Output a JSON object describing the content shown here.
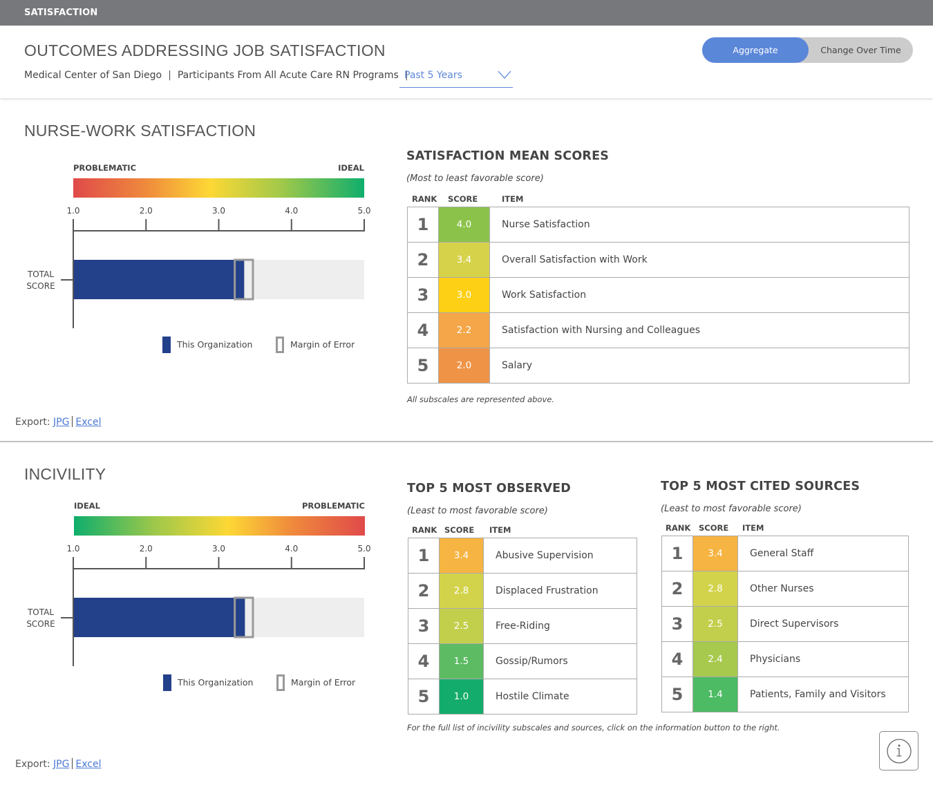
{
  "topbar": {
    "title": "SATISFACTION"
  },
  "header": {
    "title": "OUTCOMES ADDRESSING JOB SATISFACTION",
    "organization": "Medical Center of San Diego",
    "participants": "Participants From All Acute Care RN Programs",
    "separator": "|",
    "period_select": {
      "value": "Past 5 Years"
    },
    "view_toggle": {
      "options": [
        "Aggregate",
        "Change Over Time"
      ],
      "selected": "Aggregate"
    }
  },
  "colors": {
    "accent": "#5b87d9",
    "org_bar": "#23408a",
    "margin_of_error": "#999999",
    "bar_track": "#eeeeee"
  },
  "sections": [
    {
      "title": "NURSE-WORK SATISFACTION",
      "scale": {
        "left_label": "PROBLEMATIC",
        "right_label": "IDEAL"
      },
      "legend": {
        "org": "This Organization",
        "moe": "Margin of Error"
      },
      "export": {
        "label": "Export:",
        "links": [
          "JPG",
          "Excel"
        ]
      },
      "tables": [
        {
          "title": "SATISFACTION MEAN SCORES",
          "subtitle": "(Most to least favorable score)",
          "headers": [
            "RANK",
            "SCORE",
            "ITEM"
          ],
          "rows": [
            {
              "rank": "1",
              "score": "4.0",
              "item": "Nurse Satisfaction",
              "color": "#8bc34a"
            },
            {
              "rank": "2",
              "score": "3.4",
              "item": "Overall Satisfaction with Work",
              "color": "#d6d24a"
            },
            {
              "rank": "3",
              "score": "3.0",
              "item": "Work Satisfaction",
              "color": "#fdd015"
            },
            {
              "rank": "4",
              "score": "2.2",
              "item": "Satisfaction with Nursing and Colleagues",
              "color": "#f4a648"
            },
            {
              "rank": "5",
              "score": "2.0",
              "item": "Salary",
              "color": "#ef9447"
            }
          ],
          "note": "All subscales are represented above."
        }
      ]
    },
    {
      "title": "INCIVILITY",
      "scale": {
        "left_label": "IDEAL",
        "right_label": "PROBLEMATIC"
      },
      "legend": {
        "org": "This Organization",
        "moe": "Margin of Error"
      },
      "export": {
        "label": "Export:",
        "links": [
          "JPG",
          "Excel"
        ]
      },
      "tables": [
        {
          "title": "TOP 5 MOST OBSERVED",
          "subtitle": "(Least to most favorable score)",
          "headers": [
            "RANK",
            "SCORE",
            "ITEM"
          ],
          "rows": [
            {
              "rank": "1",
              "score": "3.4",
              "item": "Abusive Supervision",
              "color": "#f6b442"
            },
            {
              "rank": "2",
              "score": "2.8",
              "item": "Displaced Frustration",
              "color": "#d3d34b"
            },
            {
              "rank": "3",
              "score": "2.5",
              "item": "Free-Riding",
              "color": "#c2cf4c"
            },
            {
              "rank": "4",
              "score": "1.5",
              "item": "Gossip/Rumors",
              "color": "#5dbb63"
            },
            {
              "rank": "5",
              "score": "1.0",
              "item": "Hostile Climate",
              "color": "#14ac6c"
            }
          ]
        },
        {
          "title": "TOP 5 MOST CITED SOURCES",
          "subtitle": "(Least to most favorable score)",
          "headers": [
            "RANK",
            "SCORE",
            "ITEM"
          ],
          "rows": [
            {
              "rank": "1",
              "score": "3.4",
              "item": "General Staff",
              "color": "#f6b442"
            },
            {
              "rank": "2",
              "score": "2.8",
              "item": "Other Nurses",
              "color": "#d3d34b"
            },
            {
              "rank": "3",
              "score": "2.5",
              "item": "Direct Supervisors",
              "color": "#c2cf4c"
            },
            {
              "rank": "4",
              "score": "2.4",
              "item": "Physicians",
              "color": "#a6c94e"
            },
            {
              "rank": "5",
              "score": "1.4",
              "item": "Patients, Family and Visitors",
              "color": "#4cbb63"
            }
          ]
        }
      ],
      "note": "For the full list of incivility subscales and sources, click on the information button to the right."
    }
  ],
  "chart_data": [
    {
      "type": "bar",
      "title": "NURSE-WORK SATISFACTION",
      "categories": [
        "TOTAL SCORE"
      ],
      "series": [
        {
          "name": "This Organization",
          "values": [
            3.35
          ]
        }
      ],
      "margin_of_error": [
        {
          "low": 3.22,
          "high": 3.47
        }
      ],
      "x_ticks": [
        "1.0",
        "2.0",
        "3.0",
        "4.0",
        "5.0"
      ],
      "xlim": [
        1,
        5
      ],
      "scale_labels": {
        "low": "PROBLEMATIC",
        "high": "IDEAL"
      },
      "legend": [
        "This Organization",
        "Margin of Error"
      ],
      "legend_position": "bottom-right"
    },
    {
      "type": "bar",
      "title": "INCIVILITY",
      "categories": [
        "TOTAL SCORE"
      ],
      "series": [
        {
          "name": "This Organization",
          "values": [
            3.36
          ]
        }
      ],
      "margin_of_error": [
        {
          "low": 3.22,
          "high": 3.47
        }
      ],
      "x_ticks": [
        "1.0",
        "2.0",
        "3.0",
        "4.0",
        "5.0"
      ],
      "xlim": [
        1,
        5
      ],
      "scale_labels": {
        "low": "IDEAL",
        "high": "PROBLEMATIC"
      },
      "legend": [
        "This Organization",
        "Margin of Error"
      ],
      "legend_position": "bottom-right"
    }
  ]
}
